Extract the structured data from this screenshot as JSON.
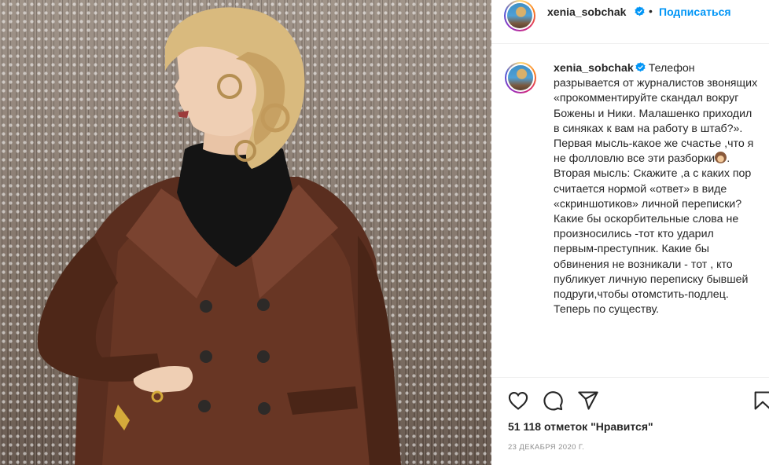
{
  "post": {
    "username": "xenia_sobchak",
    "verified": true,
    "header_separator": "•",
    "follow_label": "Подписаться",
    "caption_lines": [
      "Телефон разрывается от журналистов звонящих «прокомментируйте скандал вокруг Божены и Ники. Малашенко приходил в синяках к вам на работу в штаб?». Первая мысль-какое же счастье ,что я не фолловлю все эти разборки",
      "Вторая мысль: Скажите ,а с каких пор считается нормой «ответ» в виде «скриншотиков» личной переписки?",
      "Какие бы оскорбительные слова не произносились -тот кто ударил первым-преступник. Какие бы обвинения не возникали - тот , кто публикует личную переписку бывшей подруги,чтобы отомстить-подлец.",
      "Теперь по существу."
    ],
    "caption_emoji_icon": "see-no-evil-monkey-icon",
    "likes_text": "51 118 отметок \"Нравится\"",
    "date_text": "23 ДЕКАБРЯ 2020 Г."
  },
  "actions": {
    "like_icon": "heart-icon",
    "comment_icon": "comment-icon",
    "share_icon": "share-icon",
    "save_icon": "bookmark-icon"
  },
  "colors": {
    "accent": "#0095f6",
    "text": "#262626",
    "muted": "#8e8e8e",
    "divider": "#efefef"
  }
}
